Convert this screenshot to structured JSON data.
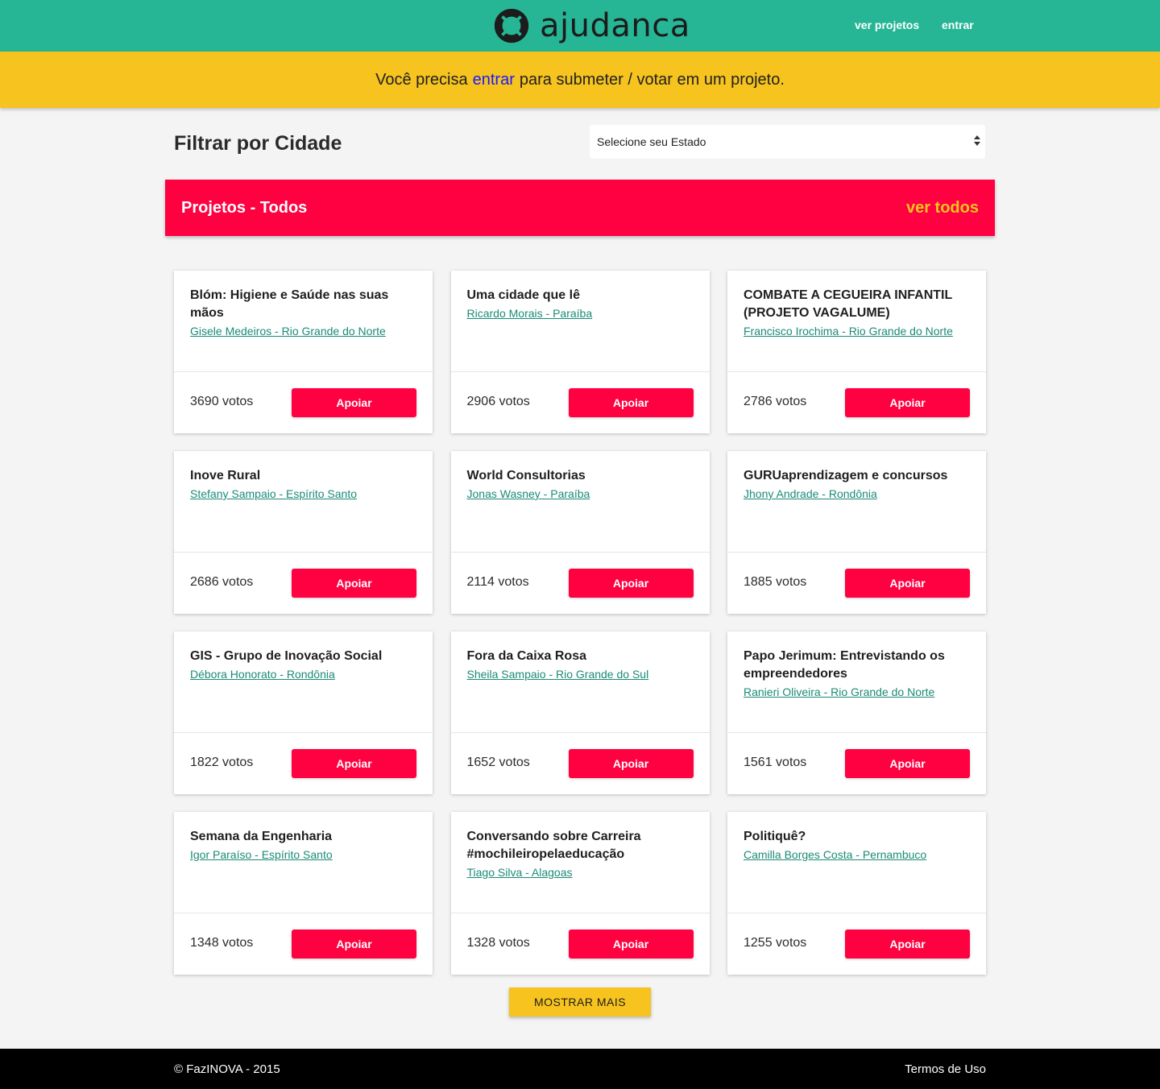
{
  "brand": {
    "name": "ajudanca",
    "logo_icon": "lifebuoy-icon"
  },
  "nav": {
    "projects": "ver projetos",
    "login": "entrar"
  },
  "alert": {
    "before": "Você precisa",
    "link": "entrar",
    "after": "para submeter / votar em um projeto."
  },
  "filter": {
    "title": "Filtrar por Cidade",
    "select_value": "Selecione seu Estado"
  },
  "projects_header": {
    "title": "Projetos - Todos",
    "view_all": "ver todos"
  },
  "colors": {
    "topbar": "#26b695",
    "alert": "#f7c31e",
    "accent": "#ff0040",
    "link": "#1a8a78"
  },
  "projects": [
    {
      "title": "Blóm: Higiene e Saúde nas suas mãos",
      "author": "Gisele Medeiros - Rio Grande do Norte",
      "votes": "3690 votos",
      "button": "Apoiar"
    },
    {
      "title": "Uma cidade que lê",
      "author": "Ricardo Morais - Paraíba",
      "votes": "2906 votos",
      "button": "Apoiar"
    },
    {
      "title": "COMBATE A CEGUEIRA INFANTIL (PROJETO VAGALUME)",
      "author": "Francisco Irochima - Rio Grande do Norte",
      "votes": "2786 votos",
      "button": "Apoiar"
    },
    {
      "title": "Inove Rural",
      "author": "Stefany Sampaio - Espírito Santo",
      "votes": "2686 votos",
      "button": "Apoiar"
    },
    {
      "title": "World Consultorias",
      "author": "Jonas Wasney - Paraíba",
      "votes": "2114 votos",
      "button": "Apoiar"
    },
    {
      "title": "GURUaprendizagem e concursos",
      "author": "Jhony Andrade - Rondônia",
      "votes": "1885 votos",
      "button": "Apoiar"
    },
    {
      "title": "GIS - Grupo de Inovação Social",
      "author": "Débora Honorato - Rondônia",
      "votes": "1822 votos",
      "button": "Apoiar"
    },
    {
      "title": "Fora da Caixa Rosa",
      "author": "Sheila Sampaio - Rio Grande do Sul",
      "votes": "1652 votos",
      "button": "Apoiar"
    },
    {
      "title": "Papo Jerimum: Entrevistando os empreendedores",
      "author": "Ranieri Oliveira - Rio Grande do Norte",
      "votes": "1561 votos",
      "button": "Apoiar"
    },
    {
      "title": "Semana da Engenharia",
      "author": "Igor Paraíso - Espírito Santo",
      "votes": "1348 votos",
      "button": "Apoiar"
    },
    {
      "title": "Conversando sobre Carreira #mochileiropelaeducação",
      "author": "Tiago Silva - Alagoas",
      "votes": "1328 votos",
      "button": "Apoiar"
    },
    {
      "title": "Politiquê?",
      "author": "Camilla Borges Costa - Pernambuco",
      "votes": "1255 votos",
      "button": "Apoiar"
    }
  ],
  "more_button": "MOSTRAR MAIS",
  "footer": {
    "copyright": "© FazINOVA - 2015",
    "terms": "Termos de Uso"
  }
}
